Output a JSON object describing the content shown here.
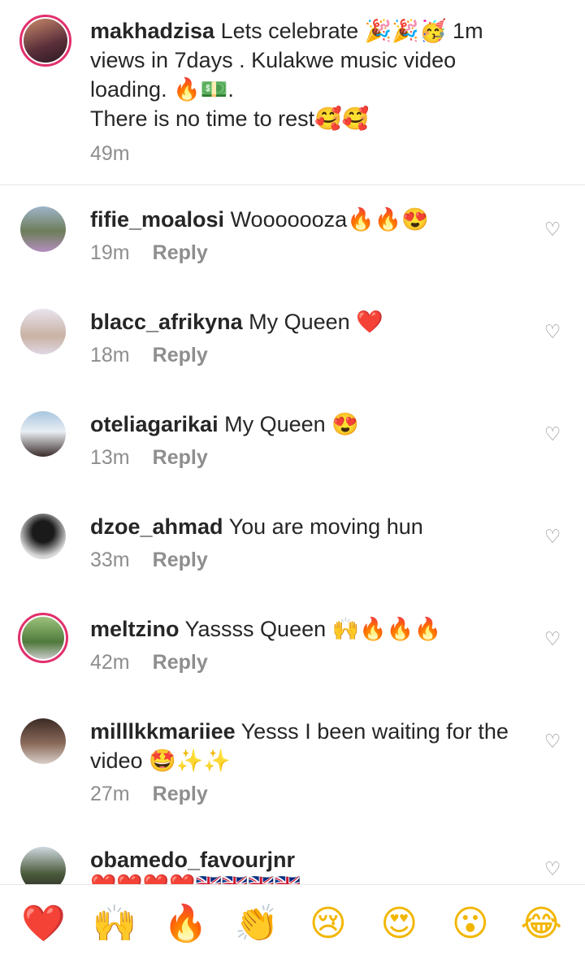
{
  "caption": {
    "username": "makhadzisa",
    "text": "Lets celebrate 🎉🎉🥳 1m views in 7days . Kulakwe music video loading. 🔥💵.",
    "text2": "There is no time to rest🥰🥰",
    "time": "49m"
  },
  "comments": [
    {
      "username": "fifie_moalosi",
      "text": "Wooooooza🔥🔥😍",
      "time": "19m",
      "reply": "Reply"
    },
    {
      "username": "blacc_afrikyna",
      "text": "My Queen ❤️",
      "time": "18m",
      "reply": "Reply"
    },
    {
      "username": "oteliagarikai",
      "text": "My Queen 😍",
      "time": "13m",
      "reply": "Reply"
    },
    {
      "username": "dzoe_ahmad",
      "text": "You are moving hun",
      "time": "33m",
      "reply": "Reply"
    },
    {
      "username": "meltzino",
      "text": "Yassss Queen 🙌🔥🔥🔥",
      "time": "42m",
      "reply": "Reply"
    },
    {
      "username": "milllkkmariiee",
      "text": "Yesss I been waiting for the video 🤩✨✨",
      "time": "27m",
      "reply": "Reply"
    },
    {
      "username": "obamedo_favourjnr",
      "text": "❤️❤️❤️❤️🇬🇧🇬🇧🇬🇧🇬🇧"
    }
  ],
  "like_icon": "heart-outline-icon",
  "reactions": [
    "❤️",
    "🙌",
    "🔥",
    "👏",
    "😢",
    "😍",
    "😮",
    "😂"
  ],
  "colors": {
    "ring": "#e1306c",
    "muted": "#8e8e8e",
    "text": "#262626"
  }
}
